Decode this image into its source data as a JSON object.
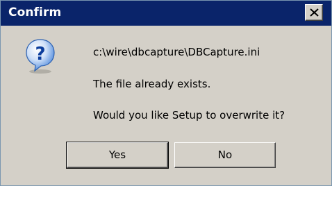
{
  "window": {
    "title": "Confirm",
    "close_label": "×"
  },
  "message": {
    "icon": "question-icon",
    "lines": [
      "c:\\wire\\dbcapture\\DBCapture.ini",
      "The file already exists.",
      "Would you like Setup to overwrite it?"
    ]
  },
  "buttons": {
    "yes_label": "Yes",
    "no_label": "No"
  },
  "colors": {
    "titlebar": "#0a246a",
    "dialog_face": "#d4d0c8",
    "icon_blue": "#2a6fd0"
  }
}
